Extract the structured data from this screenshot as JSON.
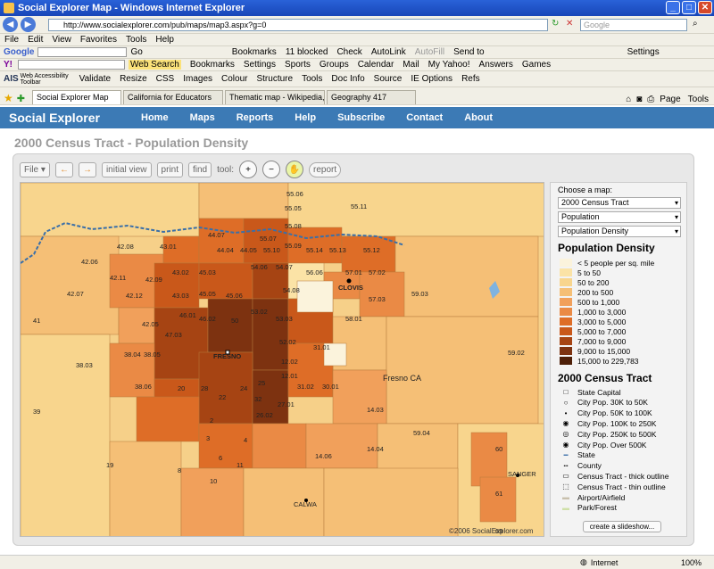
{
  "window": {
    "title": "Social Explorer Map - Windows Internet Explorer"
  },
  "address": {
    "url": "http://www.socialexplorer.com/pub/maps/map3.aspx?g=0",
    "search_placeholder": "Google"
  },
  "menu": [
    "File",
    "Edit",
    "View",
    "Favorites",
    "Tools",
    "Help"
  ],
  "google_bar": {
    "go": "Go",
    "bookmarks": "Bookmarks",
    "blocked": "11 blocked",
    "check": "Check",
    "autolink": "AutoLink",
    "autofill": "AutoFill",
    "send_to": "Send to",
    "settings": "Settings"
  },
  "yahoo_bar": {
    "web_search": "Web Search",
    "bookmarks": "Bookmarks",
    "settings": "Settings",
    "sports": "Sports",
    "groups": "Groups",
    "calendar": "Calendar",
    "mail": "Mail",
    "my_yahoo": "My Yahoo!",
    "answers": "Answers",
    "games": "Games"
  },
  "ais_bar": {
    "label": "Web Accessibility Toolbar",
    "validate": "Validate",
    "resize": "Resize",
    "css": "CSS",
    "images": "Images",
    "colour": "Colour",
    "structure": "Structure",
    "tools": "Tools",
    "doc_info": "Doc Info",
    "source": "Source",
    "ie_options": "IE Options",
    "refs": "Refs"
  },
  "tabs": [
    "Social Explorer Map",
    "California for Educators",
    "Thematic map - Wikipedia, th...",
    "Geography 417"
  ],
  "tab_tools": {
    "page": "Page",
    "tools": "Tools"
  },
  "site": {
    "brand": "Social Explorer",
    "nav": [
      "Home",
      "Maps",
      "Reports",
      "Help",
      "Subscribe",
      "Contact",
      "About"
    ],
    "page_title": "2000 Census Tract - Population Density"
  },
  "toolbar": {
    "file": "File",
    "initial_view": "initial view",
    "print": "print",
    "find": "find",
    "tool_label": "tool:",
    "report": "report"
  },
  "sidebar": {
    "choose_label": "Choose a map:",
    "select1": "2000 Census Tract",
    "select2": "Population",
    "select3": "Population Density",
    "legend_title": "Population Density",
    "legend": [
      {
        "label": "< 5 people per sq. mile",
        "color": "#fbf3dc"
      },
      {
        "label": "5 to 50",
        "color": "#fbe3a6"
      },
      {
        "label": "50 to 200",
        "color": "#f8d58d"
      },
      {
        "label": "200 to 500",
        "color": "#f5bf76"
      },
      {
        "label": "500 to 1,000",
        "color": "#f1a05b"
      },
      {
        "label": "1,000 to 3,000",
        "color": "#ea8a45"
      },
      {
        "label": "3,000 to 5,000",
        "color": "#de6d27"
      },
      {
        "label": "5,000 to 7,000",
        "color": "#c9581a"
      },
      {
        "label": "7,000 to 9,000",
        "color": "#a64413"
      },
      {
        "label": "9,000 to 15,000",
        "color": "#7d3210"
      },
      {
        "label": "15,000 to 229,783",
        "color": "#4e1f08"
      }
    ],
    "tract_title": "2000 Census Tract",
    "tract_legend": [
      {
        "label": "State Capital",
        "icon": "square-icon"
      },
      {
        "label": "City Pop. 30K to 50K",
        "icon": "small-circle-icon"
      },
      {
        "label": "City Pop. 50K to 100K",
        "icon": "dot-icon"
      },
      {
        "label": "City Pop. 100K to 250K",
        "icon": "ring-dot-icon"
      },
      {
        "label": "City Pop. 250K to 500K",
        "icon": "target-icon"
      },
      {
        "label": "City Pop. Over 500K",
        "icon": "bullseye-icon"
      },
      {
        "label": "State",
        "icon": "state-line-icon"
      },
      {
        "label": "County",
        "icon": "county-line-icon"
      },
      {
        "label": "Census Tract - thick outline",
        "icon": "thick-box-icon"
      },
      {
        "label": "Census Tract - thin outline",
        "icon": "thin-box-icon"
      },
      {
        "label": "Airport/Airfield",
        "icon": "airport-icon"
      },
      {
        "label": "Park/Forest",
        "icon": "park-icon"
      }
    ],
    "slideshow": "create a slideshow..."
  },
  "map": {
    "copyright": "©2006 SocialExplorer.com",
    "city_labels": [
      "FRESNO",
      "CLOVIS",
      "Fresno CA",
      "SANGER",
      "CALWA"
    ],
    "tract_labels": [
      "55.06",
      "55.05",
      "55.08",
      "55.11",
      "44.07",
      "55.07",
      "55.09",
      "42.08",
      "43.01",
      "44.04",
      "44.05",
      "55.10",
      "55.14",
      "55.13",
      "55.12",
      "42.06",
      "43.02",
      "45.03",
      "54.06",
      "54.07",
      "56.06",
      "57.01",
      "57.02",
      "42.11",
      "42.09",
      "45.05",
      "42.07",
      "42.12",
      "43.03",
      "45.06",
      "54.08",
      "57.03",
      "59.03",
      "46.01",
      "46.02",
      "53.02",
      "53.03",
      "58.01",
      "42.05",
      "47.03",
      "52.02",
      "31.01",
      "38.04",
      "38.05",
      "12.02",
      "12.01",
      "38.03",
      "38.06",
      "31.02",
      "30.01",
      "14.03",
      "59.04",
      "59.02",
      "14.04",
      "14.06",
      "41",
      "39",
      "19",
      "11",
      "10",
      "8",
      "61",
      "60",
      "69",
      "20",
      "28",
      "24",
      "22",
      "27.01",
      "26.02",
      "50",
      "25",
      "32",
      "2",
      "3",
      "4",
      "6"
    ]
  },
  "status": {
    "zone": "Internet",
    "zoom": "100%"
  }
}
